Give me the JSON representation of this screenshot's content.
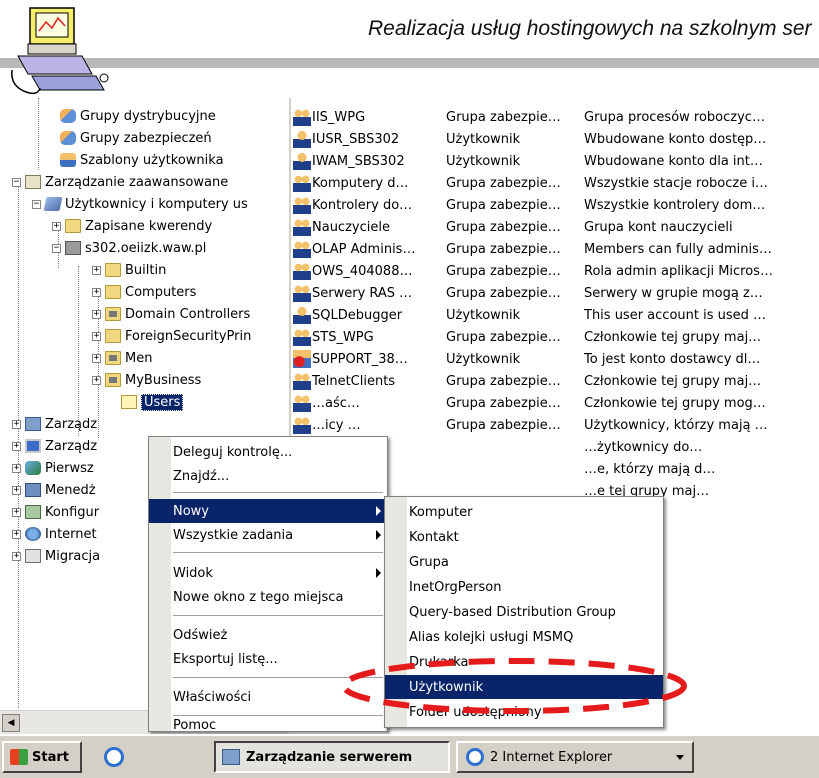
{
  "slide": {
    "title": "Realizacja usług hostingowych na szkolnym ser"
  },
  "colors": {
    "highlight": "#0a246a",
    "annotation": "#e51b1b",
    "taskbar": "#d4d0c8"
  },
  "tree": {
    "items": [
      {
        "label": "Grupy dystrybucyjne",
        "icon": "group-icon"
      },
      {
        "label": "Grupy zabezpieczeń",
        "icon": "group-icon"
      },
      {
        "label": "Szablony użytkownika",
        "icon": "user-template-icon"
      },
      {
        "label": "Zarządzanie zaawansowane",
        "icon": "admin-tools-icon"
      },
      {
        "label": "Użytkownicy i komputery us",
        "icon": "ad-users-computers-icon"
      },
      {
        "label": "Zapisane kwerendy",
        "icon": "folder-icon"
      },
      {
        "label": "s302.oeiizk.waw.pl",
        "icon": "domain-icon"
      },
      {
        "label": "Builtin",
        "icon": "folder-icon"
      },
      {
        "label": "Computers",
        "icon": "folder-icon"
      },
      {
        "label": "Domain Controllers",
        "icon": "ou-icon"
      },
      {
        "label": "ForeignSecurityPrin",
        "icon": "folder-icon"
      },
      {
        "label": "Men",
        "icon": "ou-icon"
      },
      {
        "label": "MyBusiness",
        "icon": "ou-icon"
      },
      {
        "label": "Users",
        "icon": "folder-open-icon"
      },
      {
        "label": "Zarządz",
        "icon": "server-icon"
      },
      {
        "label": "Zarządz",
        "icon": "computer-icon"
      },
      {
        "label": "Pierwsz",
        "icon": "wizard-icon"
      },
      {
        "label": "Menedż",
        "icon": "manager-icon"
      },
      {
        "label": "Konfigur",
        "icon": "config-icon"
      },
      {
        "label": "Internet",
        "icon": "internet-icon"
      },
      {
        "label": "Migracja",
        "icon": "migration-icon"
      }
    ]
  },
  "list": {
    "rows": [
      {
        "name": "IIS_WPG",
        "type": "Grupa zabezpie…",
        "desc": "Grupa procesów roboczyc…"
      },
      {
        "name": "IUSR_SBS302",
        "type": "Użytkownik",
        "desc": "Wbudowane konto dostęp…"
      },
      {
        "name": "IWAM_SBS302",
        "type": "Użytkownik",
        "desc": "Wbudowane konto dla int…"
      },
      {
        "name": "Komputery d…",
        "type": "Grupa zabezpie…",
        "desc": "Wszystkie stacje robocze i…"
      },
      {
        "name": "Kontrolery do…",
        "type": "Grupa zabezpie…",
        "desc": "Wszystkie kontrolery dom…"
      },
      {
        "name": "Nauczyciele",
        "type": "Grupa zabezpie…",
        "desc": "Grupa kont nauczycieli"
      },
      {
        "name": "OLAP Adminis…",
        "type": "Grupa zabezpie…",
        "desc": "Members can fully adminis…"
      },
      {
        "name": "OWS_404088…",
        "type": "Grupa zabezpie…",
        "desc": "Rola admin aplikacji Micros…"
      },
      {
        "name": "Serwery RAS …",
        "type": "Grupa zabezpie…",
        "desc": "Serwery w grupie mogą z…"
      },
      {
        "name": "SQLDebugger",
        "type": "Użytkownik",
        "desc": "This user account is used …"
      },
      {
        "name": "STS_WPG",
        "type": "Grupa zabezpie…",
        "desc": "Członkowie tej grupy maj…"
      },
      {
        "name": "SUPPORT_38…",
        "type": "Użytkownik",
        "desc": "To jest konto dostawcy dl…"
      },
      {
        "name": "TelnetClients",
        "type": "Grupa zabezpie…",
        "desc": "Członkowie tej grupy maj…"
      },
      {
        "name": "…aśc…",
        "type": "Grupa zabezpie…",
        "desc": "Członkowie tej grupy mog…"
      },
      {
        "name": "…icy …",
        "type": "Grupa zabezpie…",
        "desc": "Użytkownicy, którzy mają …"
      },
      {
        "name": "",
        "type": "",
        "desc": "…żytkownicy do…"
      },
      {
        "name": "",
        "type": "",
        "desc": "…e, którzy mają d…"
      },
      {
        "name": "",
        "type": "",
        "desc": "…e tej grupy maj…"
      }
    ]
  },
  "context_menu": {
    "delegate": "Deleguj kontrolę...",
    "find": "Znajdź...",
    "new": "Nowy",
    "all_tasks": "Wszystkie zadania",
    "view": "Widok",
    "new_window": "Nowe okno z tego miejsca",
    "refresh": "Odśwież",
    "export": "Eksportuj listę...",
    "properties": "Właściwości",
    "help": "Pomoc"
  },
  "submenu": {
    "items": [
      "Komputer",
      "Kontakt",
      "Grupa",
      "InetOrgPerson",
      "Query-based Distribution Group",
      "Alias kolejki usługi MSMQ",
      "Drukarka",
      "Użytkownik",
      "Folder udostępniony"
    ]
  },
  "taskbar": {
    "start": "Start",
    "active_window": "Zarządzanie serwerem",
    "ie_group": "2 Internet Explorer"
  }
}
